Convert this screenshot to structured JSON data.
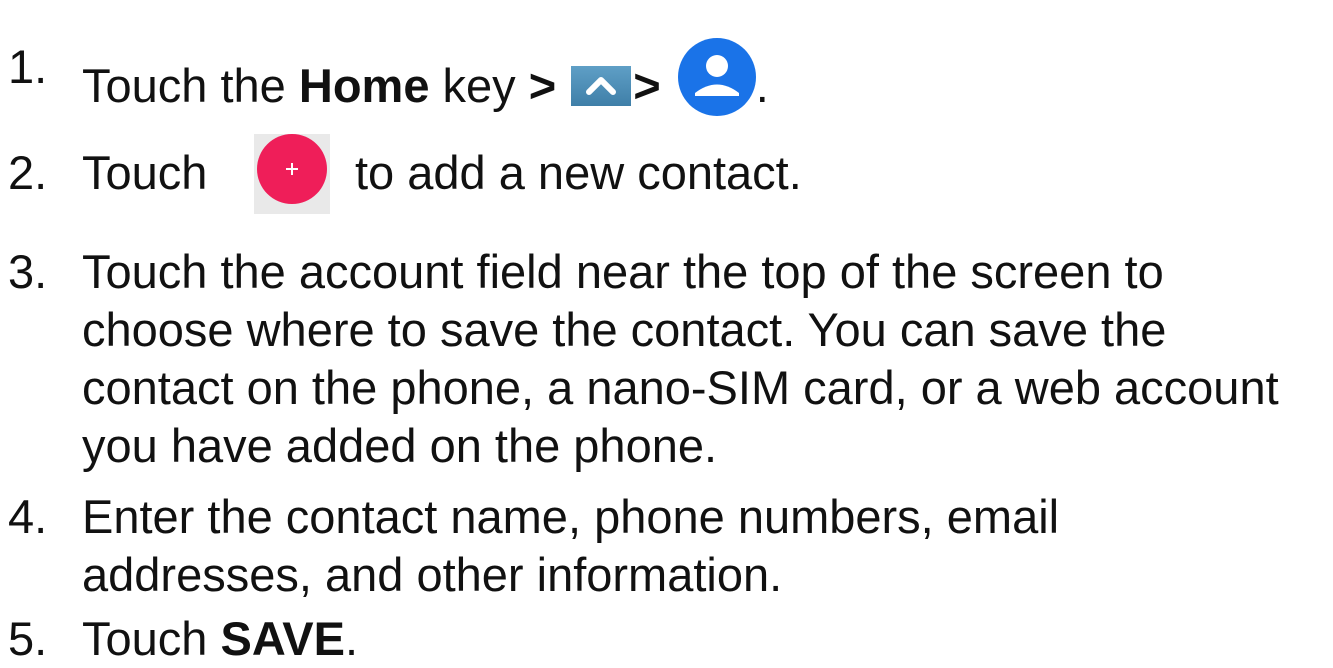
{
  "steps": [
    {
      "number": "1.",
      "parts": {
        "a": "Touch the ",
        "home": "Home",
        "b": " key ",
        "gt1": ">",
        "gt2": ">",
        "end": "."
      },
      "icons": [
        "up-arrow-icon",
        "contact-icon"
      ]
    },
    {
      "number": "2.",
      "parts": {
        "a": "Touch",
        "b": "to add a new contact."
      },
      "icons": [
        "add-icon"
      ]
    },
    {
      "number": "3.",
      "lines": [
        "Touch the account field near the top of the screen to",
        "choose where to save the contact. You can save the",
        "contact on the phone, a nano-SIM card, or a web account",
        "you have added on the phone."
      ]
    },
    {
      "number": "4.",
      "lines": [
        "Enter the contact name, phone numbers, email",
        "addresses, and other information."
      ]
    },
    {
      "number": "5.",
      "parts": {
        "a": "Touch ",
        "save": "SAVE",
        "end": "."
      }
    }
  ],
  "colors": {
    "text": "#111111",
    "contact_icon": "#1a73e8",
    "add_icon": "#ef1e59",
    "up_icon": "#4f8fb8"
  }
}
